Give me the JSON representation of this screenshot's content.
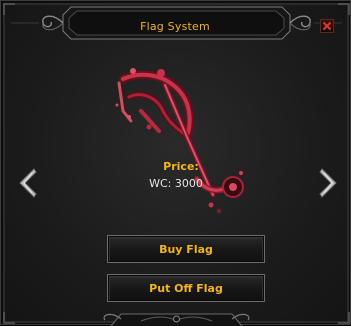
{
  "window": {
    "title": "Flag System",
    "close_icon": "close-x-icon"
  },
  "navigation": {
    "prev_icon": "chevron-left-icon",
    "next_icon": "chevron-right-icon"
  },
  "item": {
    "art_icon": "flag-item-icon",
    "price_label": "Price:",
    "price_value": "WC: 3000"
  },
  "buttons": {
    "buy_label": "Buy Flag",
    "put_off_label": "Put Off Flag"
  },
  "colors": {
    "accent_text": "#f2b619",
    "value_text": "#e6e6e6",
    "panel_bg": "#1b1b1b",
    "item_red": "#c8324a"
  }
}
